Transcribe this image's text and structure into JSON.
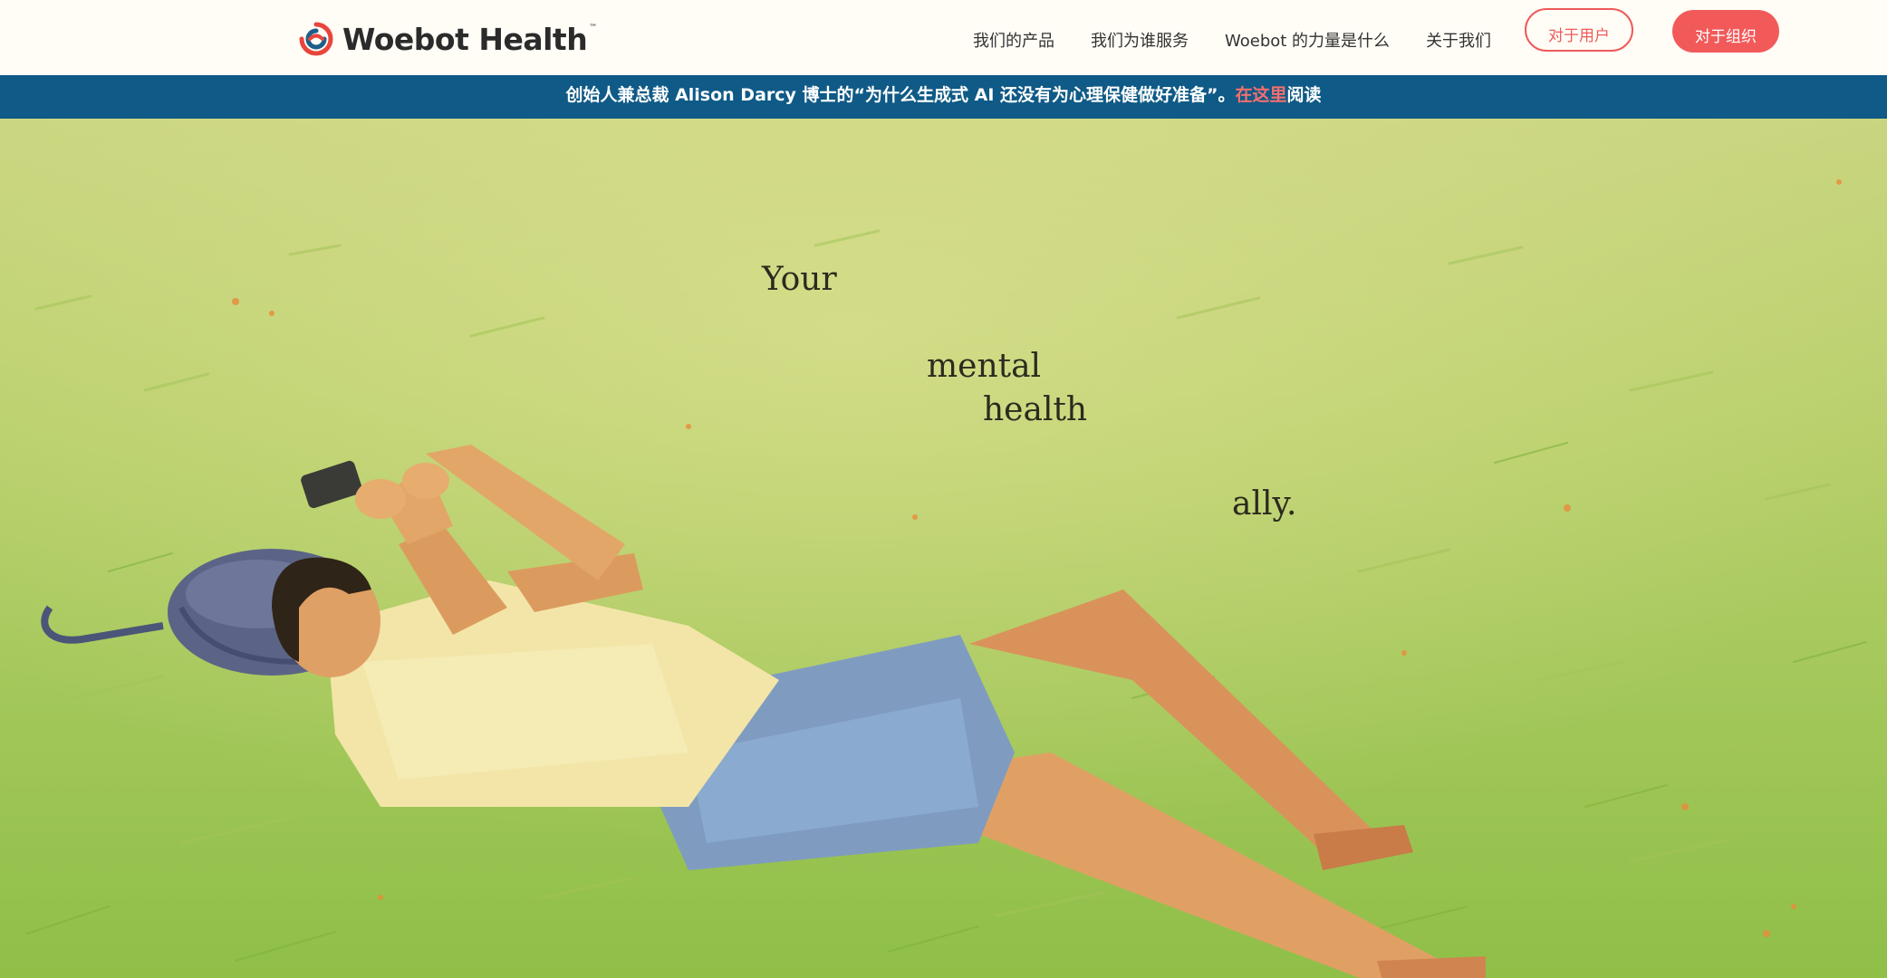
{
  "brand": {
    "logo_text": "Woebot Health",
    "trademark": "™",
    "colors": {
      "red": "#e8453c",
      "blue": "#1d5f8a"
    }
  },
  "nav": {
    "items": [
      {
        "label": "我们的产品"
      },
      {
        "label": "我们为谁服务"
      },
      {
        "label": "Woebot 的力量是什么"
      },
      {
        "label": "关于我们"
      }
    ],
    "cta_users": "对于用户",
    "cta_orgs": "对于组织"
  },
  "banner": {
    "text": "创始人兼总裁 Alison Darcy 博士的“为什么生成式 AI 还没有为心理保健做好准备”。",
    "link_text": "在这里",
    "suffix": "阅读",
    "background": "#0f5a86",
    "link_color": "#f36f6f"
  },
  "hero": {
    "tagline": {
      "word1": "Your",
      "word2": "mental",
      "word3": "health",
      "word4": "ally."
    },
    "illustration": "person-lying-in-grass-with-phone"
  }
}
